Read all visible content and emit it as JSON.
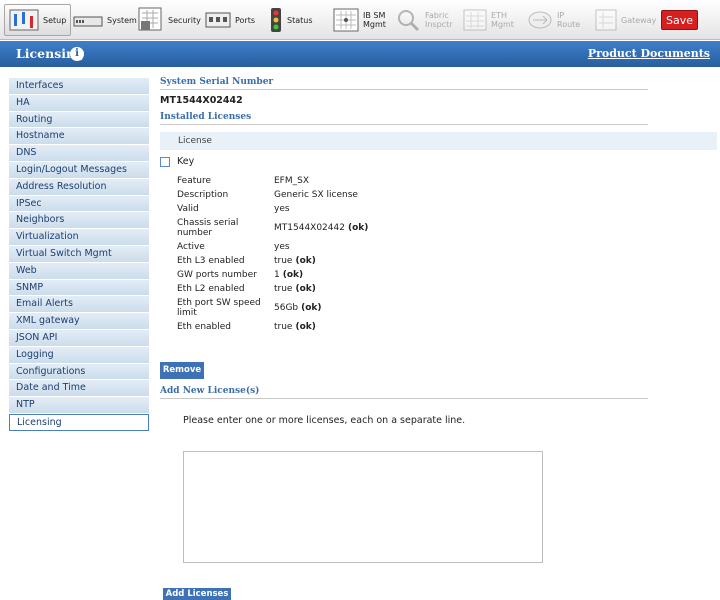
{
  "toolbar": {
    "buttons": [
      {
        "label": "Setup",
        "icon": "setup-icon"
      },
      {
        "label": "System",
        "icon": "system-icon"
      },
      {
        "label": "Security",
        "icon": "security-icon"
      },
      {
        "label": "Ports",
        "icon": "ports-icon"
      },
      {
        "label": "Status",
        "icon": "status-icon"
      },
      {
        "label": "IB SM Mgmt",
        "icon": "ib-sm-icon"
      },
      {
        "label": "Fabric Inspctr",
        "icon": "fabric-inspector-icon"
      },
      {
        "label": "ETH Mgmt",
        "icon": "eth-mgmt-icon"
      },
      {
        "label": "IP Route",
        "icon": "ip-route-icon"
      },
      {
        "label": "Gateway",
        "icon": "gateway-icon"
      }
    ],
    "save_label": "Save",
    "save_color": "#d61f1f"
  },
  "header": {
    "title": "Licensing",
    "info_icon": "info-icon",
    "product_docs": "Product Documents",
    "band_color": "#2f6cb3"
  },
  "sidebar": {
    "items": [
      {
        "label": "Interfaces"
      },
      {
        "label": "HA"
      },
      {
        "label": "Routing"
      },
      {
        "label": "Hostname"
      },
      {
        "label": "DNS"
      },
      {
        "label": "Login/Logout Messages"
      },
      {
        "label": "Address Resolution"
      },
      {
        "label": "IPSec"
      },
      {
        "label": "Neighbors"
      },
      {
        "label": "Virtualization"
      },
      {
        "label": "Virtual Switch Mgmt"
      },
      {
        "label": "Web"
      },
      {
        "label": "SNMP"
      },
      {
        "label": "Email Alerts"
      },
      {
        "label": "XML gateway"
      },
      {
        "label": "JSON API"
      },
      {
        "label": "Logging"
      },
      {
        "label": "Configurations"
      },
      {
        "label": "Date and Time"
      },
      {
        "label": "NTP"
      },
      {
        "label": "Licensing"
      }
    ],
    "active": "Licensing"
  },
  "main": {
    "serial_title": "System Serial Number",
    "serial_value": "MT1544X02442",
    "installed_title": "Installed Licenses",
    "license_header": "License",
    "key_label": "Key",
    "details": [
      {
        "label": "Feature",
        "value": "EFM_SX",
        "status": ""
      },
      {
        "label": "Description",
        "value": "Generic SX license",
        "status": ""
      },
      {
        "label": "Valid",
        "value": "yes",
        "status": ""
      },
      {
        "label": "Chassis serial number",
        "value": "MT1544X02442",
        "status": "(ok)"
      },
      {
        "label": "Active",
        "value": "yes",
        "status": ""
      },
      {
        "label": "Eth L3 enabled",
        "value": "true",
        "status": "(ok)"
      },
      {
        "label": "GW ports number",
        "value": "1",
        "status": "(ok)"
      },
      {
        "label": "Eth L2 enabled",
        "value": "true",
        "status": "(ok)"
      },
      {
        "label": "Eth port SW speed limit",
        "value": "56Gb",
        "status": "(ok)"
      },
      {
        "label": "Eth enabled",
        "value": "true",
        "status": "(ok)"
      }
    ],
    "remove_label": "Remove",
    "add_title": "Add New License(s)",
    "instruction": "Please enter one or more licenses, each on a separate line.",
    "textarea_value": "",
    "add_button": "Add Licenses"
  }
}
